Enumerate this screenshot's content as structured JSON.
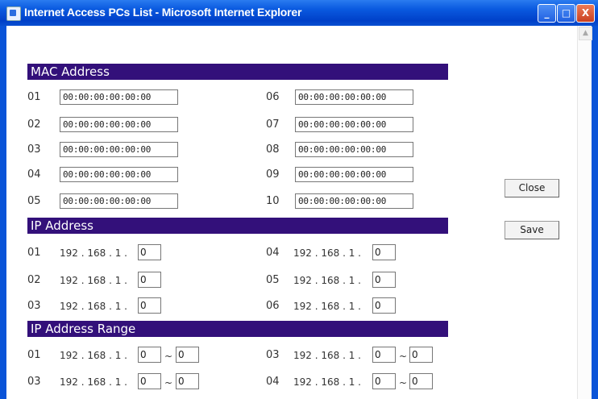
{
  "window": {
    "title": "Internet Access PCs List - Microsoft Internet Explorer",
    "minimize": "_",
    "maximize": "□",
    "close": "X"
  },
  "sections": {
    "mac_title": "MAC Address",
    "ip_title": "IP Address",
    "range_title": "IP Address Range"
  },
  "mac": {
    "left": [
      {
        "label": "01",
        "value": "00:00:00:00:00:00"
      },
      {
        "label": "02",
        "value": "00:00:00:00:00:00"
      },
      {
        "label": "03",
        "value": "00:00:00:00:00:00"
      },
      {
        "label": "04",
        "value": "00:00:00:00:00:00"
      },
      {
        "label": "05",
        "value": "00:00:00:00:00:00"
      }
    ],
    "right": [
      {
        "label": "06",
        "value": "00:00:00:00:00:00"
      },
      {
        "label": "07",
        "value": "00:00:00:00:00:00"
      },
      {
        "label": "08",
        "value": "00:00:00:00:00:00"
      },
      {
        "label": "09",
        "value": "00:00:00:00:00:00"
      },
      {
        "label": "10",
        "value": "00:00:00:00:00:00"
      }
    ]
  },
  "ip_prefix": "192 . 168 . 1 .",
  "ip": {
    "left": [
      {
        "label": "01",
        "value": "0"
      },
      {
        "label": "02",
        "value": "0"
      },
      {
        "label": "03",
        "value": "0"
      }
    ],
    "right": [
      {
        "label": "04",
        "value": "0"
      },
      {
        "label": "05",
        "value": "0"
      },
      {
        "label": "06",
        "value": "0"
      }
    ]
  },
  "range": {
    "tilde": "~",
    "left": [
      {
        "label": "01",
        "from": "0",
        "to": "0"
      },
      {
        "label": "03",
        "from": "0",
        "to": "0"
      }
    ],
    "right": [
      {
        "label": "03",
        "from": "0",
        "to": "0"
      },
      {
        "label": "04",
        "from": "0",
        "to": "0"
      }
    ]
  },
  "buttons": {
    "close": "Close",
    "save": "Save"
  }
}
